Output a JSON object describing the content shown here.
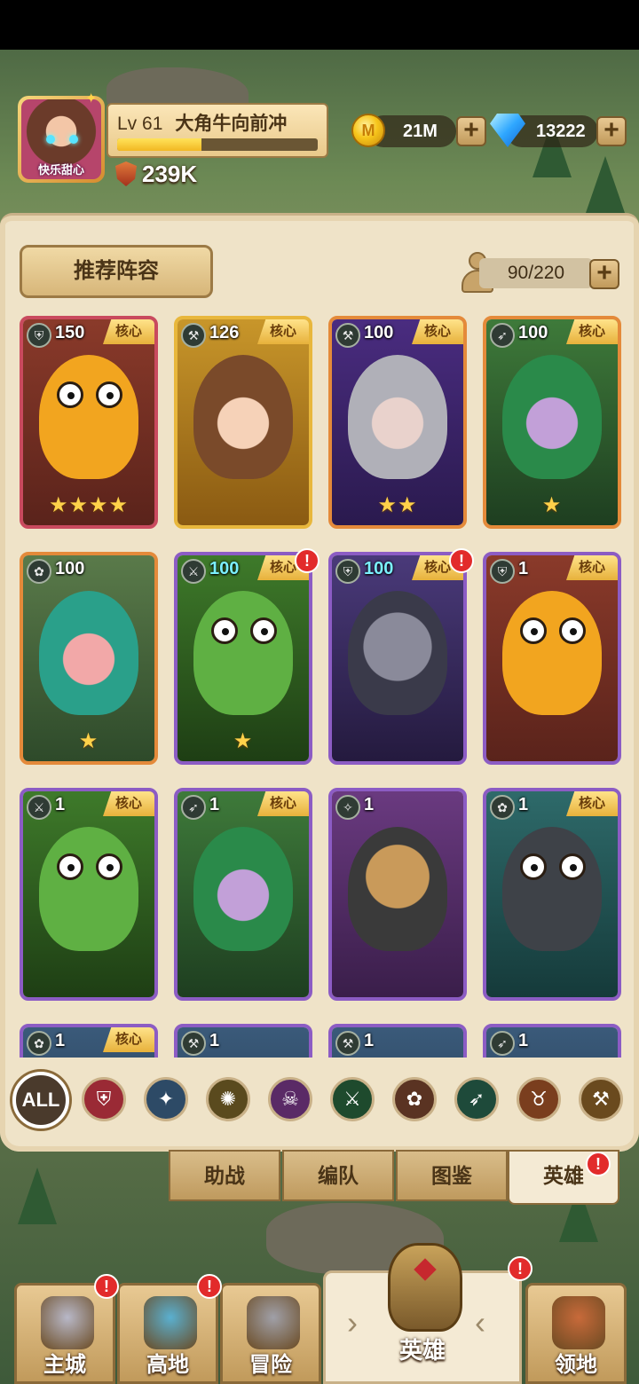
{
  "player": {
    "nickname_avatar": "快乐甜心",
    "level": "Lv 61",
    "name": "大角牛向前冲",
    "xp_fraction": 0.42,
    "power": "239K"
  },
  "currency": {
    "gold": "21M",
    "gold_icon_glyph": "M",
    "gems": "13222"
  },
  "panel": {
    "recommend_label": "推荐阵容",
    "capacity": "90/220"
  },
  "heroes": [
    {
      "level": "150",
      "core": "核心",
      "stars": "★★★★",
      "class_icon": "shield-icon",
      "rarity": "red",
      "art": "orange-beast"
    },
    {
      "level": "126",
      "core": "核心",
      "stars": "",
      "class_icon": "axe-icon",
      "rarity": "gold",
      "art": "brown-hair-girl"
    },
    {
      "level": "100",
      "core": "核心",
      "stars": "★★",
      "class_icon": "axe-icon",
      "rarity": "orange",
      "art": "silver-hair-vampire"
    },
    {
      "level": "100",
      "core": "核心",
      "stars": "★",
      "class_icon": "bow-icon",
      "rarity": "orange",
      "art": "elf-archer"
    },
    {
      "level": "100",
      "core": "",
      "stars": "★",
      "class_icon": "paw-icon",
      "rarity": "orange",
      "art": "dryad"
    },
    {
      "level": "100",
      "core": "核心",
      "stars": "★",
      "class_icon": "swords-icon",
      "rarity": "purple",
      "art": "green-orc",
      "alert": "!"
    },
    {
      "level": "100",
      "core": "核心",
      "stars": "",
      "class_icon": "shield-icon",
      "rarity": "purple",
      "art": "dark-knight",
      "alert": "!"
    },
    {
      "level": "1",
      "core": "核心",
      "stars": "",
      "class_icon": "shield-icon",
      "rarity": "purple",
      "art": "orange-beast"
    },
    {
      "level": "1",
      "core": "核心",
      "stars": "",
      "class_icon": "swords-icon",
      "rarity": "purple",
      "art": "green-orc"
    },
    {
      "level": "1",
      "core": "核心",
      "stars": "",
      "class_icon": "bow-icon",
      "rarity": "purple",
      "art": "elf-archer"
    },
    {
      "level": "1",
      "core": "",
      "stars": "",
      "class_icon": "staff-icon",
      "rarity": "purple",
      "art": "bearded-sage"
    },
    {
      "level": "1",
      "core": "核心",
      "stars": "",
      "class_icon": "paw-icon",
      "rarity": "purple",
      "art": "dark-bull"
    },
    {
      "level": "1",
      "core": "核心",
      "stars": "",
      "class_icon": "paw-icon",
      "rarity": "purple",
      "art": "partial"
    },
    {
      "level": "1",
      "core": "",
      "stars": "",
      "class_icon": "axe-icon",
      "rarity": "purple",
      "art": "partial"
    },
    {
      "level": "1",
      "core": "",
      "stars": "",
      "class_icon": "axe-icon",
      "rarity": "purple",
      "art": "partial"
    },
    {
      "level": "1",
      "core": "",
      "stars": "",
      "class_icon": "bow-icon",
      "rarity": "purple",
      "art": "partial"
    }
  ],
  "filters": {
    "all_label": "ALL",
    "items": [
      {
        "icon": "shield-icon",
        "color": "#9a2a35"
      },
      {
        "icon": "mage-icon",
        "color": "#2d4a66"
      },
      {
        "icon": "holy-icon",
        "color": "#5a4a1e"
      },
      {
        "icon": "skull-icon",
        "color": "#5a2a66"
      },
      {
        "icon": "swords-icon",
        "color": "#1e4a2d"
      },
      {
        "icon": "paw-icon",
        "color": "#5a3322"
      },
      {
        "icon": "bow-icon",
        "color": "#1e4a3a"
      },
      {
        "icon": "beast-icon",
        "color": "#7a3e1e"
      },
      {
        "icon": "axe-icon",
        "color": "#6a4a1e"
      }
    ]
  },
  "tabs": [
    {
      "label": "助战"
    },
    {
      "label": "编队"
    },
    {
      "label": "图鉴"
    },
    {
      "label": "英雄",
      "alert": "!"
    }
  ],
  "nav": {
    "items": [
      {
        "label": "主城",
        "alert": "!"
      },
      {
        "label": "高地",
        "alert": "!"
      },
      {
        "label": "冒险"
      },
      {
        "label": "英雄",
        "alert": "!"
      },
      {
        "label": "领地"
      }
    ]
  },
  "colors": {
    "accent_gold": "#e8b73c",
    "alert_red": "#e22b2b",
    "parchment": "#efe3c8"
  }
}
